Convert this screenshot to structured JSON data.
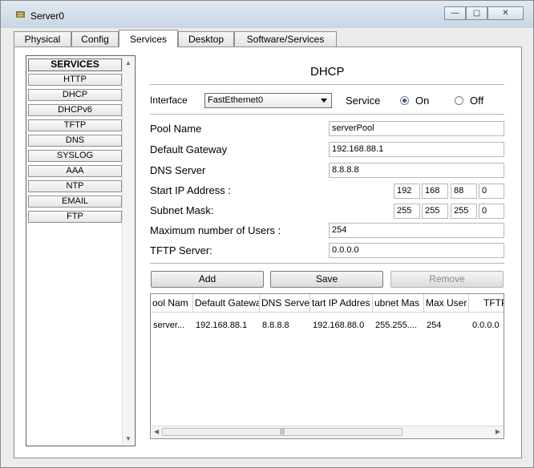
{
  "window": {
    "title": "Server0",
    "minimize_glyph": "—",
    "maximize_glyph": "▢",
    "close_glyph": "✕"
  },
  "tabs": [
    {
      "label": "Physical",
      "active": false
    },
    {
      "label": "Config",
      "active": false
    },
    {
      "label": "Services",
      "active": true
    },
    {
      "label": "Desktop",
      "active": false
    },
    {
      "label": "Software/Services",
      "active": false
    }
  ],
  "services": {
    "heading": "SERVICES",
    "items": [
      "HTTP",
      "DHCP",
      "DHCPv6",
      "TFTP",
      "DNS",
      "SYSLOG",
      "AAA",
      "NTP",
      "EMAIL",
      "FTP"
    ]
  },
  "dhcp": {
    "title": "DHCP",
    "interface_label": "Interface",
    "interface_value": "FastEthernet0",
    "service_label": "Service",
    "on_label": "On",
    "off_label": "Off",
    "service_state": "On",
    "pool_name_label": "Pool Name",
    "pool_name": "serverPool",
    "gateway_label": "Default Gateway",
    "gateway": "192.168.88.1",
    "dns_label": "DNS Server",
    "dns": "8.8.8.8",
    "start_ip_label": "Start IP Address :",
    "start_ip": [
      "192",
      "168",
      "88",
      "0"
    ],
    "mask_label": "Subnet Mask:",
    "mask": [
      "255",
      "255",
      "255",
      "0"
    ],
    "max_users_label": "Maximum number of Users :",
    "max_users": "254",
    "tftp_label": "TFTP Server:",
    "tftp": "0.0.0.0",
    "buttons": {
      "add": "Add",
      "save": "Save",
      "remove": "Remove"
    }
  },
  "table": {
    "columns": [
      "ool Nam",
      "Default Gatewa",
      "DNS Server",
      "tart IP Addres",
      "ubnet Mas",
      "Max User",
      "TFTP"
    ],
    "rows": [
      [
        "server...",
        "192.168.88.1",
        "8.8.8.8",
        "192.168.88.0",
        "255.255....",
        "254",
        "0.0.0.0"
      ]
    ]
  },
  "colors": {
    "title_bar": "#dfe9f2",
    "radio_selected": "#2a57a0"
  }
}
